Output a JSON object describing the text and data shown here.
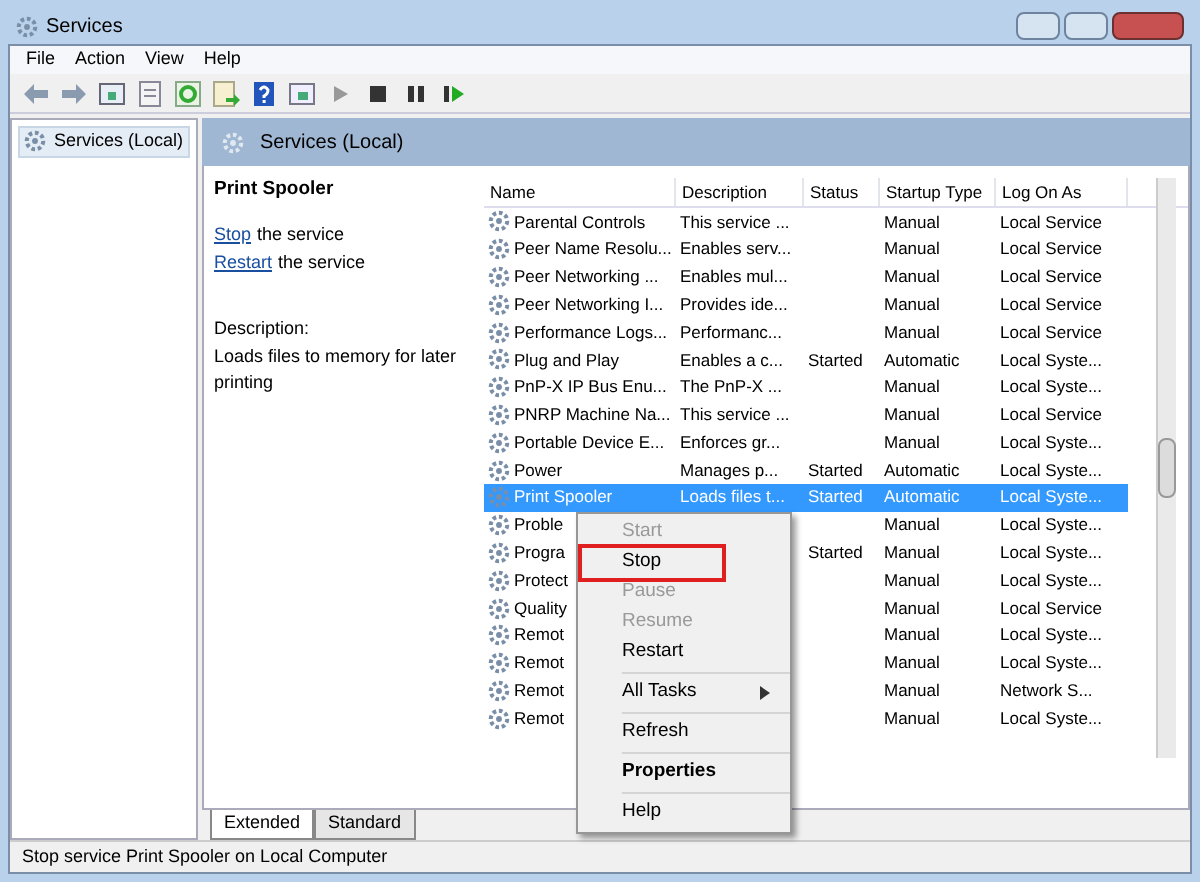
{
  "window": {
    "title": "Services"
  },
  "menu_bar": [
    "File",
    "Action",
    "View",
    "Help"
  ],
  "tree": {
    "items": [
      {
        "label": "Services (Local)",
        "selected": true
      }
    ]
  },
  "pane_header": {
    "title": "Services (Local)"
  },
  "details": {
    "title": "Print Spooler",
    "actions": [
      {
        "link": "Stop",
        "text": "the service"
      },
      {
        "link": "Restart",
        "text": "the service"
      }
    ],
    "description_label": "Description:",
    "description": "Loads files to memory for later printing"
  },
  "table": {
    "columns": [
      "Name",
      "Description",
      "Status",
      "Startup Type",
      "Log On As"
    ],
    "rows": [
      {
        "cells": [
          "Parental Controls",
          "This service ...",
          "",
          "Manual",
          "Local Service"
        ],
        "selected": false
      },
      {
        "cells": [
          "Peer Name Resolu...",
          "Enables serv...",
          "",
          "Manual",
          "Local Service"
        ],
        "selected": false
      },
      {
        "cells": [
          "Peer Networking ...",
          "Enables mul...",
          "",
          "Manual",
          "Local Service"
        ],
        "selected": false
      },
      {
        "cells": [
          "Peer Networking I...",
          "Provides ide...",
          "",
          "Manual",
          "Local Service"
        ],
        "selected": false
      },
      {
        "cells": [
          "Performance Logs...",
          "Performanc...",
          "",
          "Manual",
          "Local Service"
        ],
        "selected": false
      },
      {
        "cells": [
          "Plug and Play",
          "Enables a c...",
          "Started",
          "Automatic",
          "Local Syste..."
        ],
        "selected": false
      },
      {
        "cells": [
          "PnP-X IP Bus Enu...",
          "The PnP-X ...",
          "",
          "Manual",
          "Local Syste..."
        ],
        "selected": false
      },
      {
        "cells": [
          "PNRP Machine Na...",
          "This service ...",
          "",
          "Manual",
          "Local Service"
        ],
        "selected": false
      },
      {
        "cells": [
          "Portable Device E...",
          "Enforces gr...",
          "",
          "Manual",
          "Local Syste..."
        ],
        "selected": false
      },
      {
        "cells": [
          "Power",
          "Manages p...",
          "Started",
          "Automatic",
          "Local Syste..."
        ],
        "selected": false
      },
      {
        "cells": [
          "Print Spooler",
          "Loads files t...",
          "Started",
          "Automatic",
          "Local Syste..."
        ],
        "selected": true
      },
      {
        "cells": [
          "Proble",
          "",
          "",
          "Manual",
          "Local Syste..."
        ],
        "selected": false
      },
      {
        "cells": [
          "Progra",
          "",
          "Started",
          "Manual",
          "Local Syste..."
        ],
        "selected": false
      },
      {
        "cells": [
          "Protect",
          "",
          "",
          "Manual",
          "Local Syste..."
        ],
        "selected": false
      },
      {
        "cells": [
          "Quality",
          "",
          "",
          "Manual",
          "Local Service"
        ],
        "selected": false
      },
      {
        "cells": [
          "Remot",
          "",
          "",
          "Manual",
          "Local Syste..."
        ],
        "selected": false
      },
      {
        "cells": [
          "Remot",
          "",
          "",
          "Manual",
          "Local Syste..."
        ],
        "selected": false
      },
      {
        "cells": [
          "Remot",
          "",
          "",
          "Manual",
          "Network S..."
        ],
        "selected": false
      },
      {
        "cells": [
          "Remot",
          "",
          "",
          "Manual",
          "Local Syste..."
        ],
        "selected": false
      }
    ]
  },
  "context_menu": [
    {
      "kind": "item",
      "label": "Start",
      "disabled": true,
      "highlighted": false
    },
    {
      "kind": "item",
      "label": "Stop",
      "disabled": false,
      "highlighted": true
    },
    {
      "kind": "item",
      "label": "Pause",
      "disabled": true,
      "highlighted": false
    },
    {
      "kind": "item",
      "label": "Resume",
      "disabled": true,
      "highlighted": false
    },
    {
      "kind": "item",
      "label": "Restart",
      "disabled": false,
      "highlighted": false
    },
    {
      "kind": "separator"
    },
    {
      "kind": "submenu",
      "label": "All Tasks",
      "disabled": false,
      "highlighted": false
    },
    {
      "kind": "separator"
    },
    {
      "kind": "item",
      "label": "Refresh",
      "disabled": false,
      "highlighted": false
    },
    {
      "kind": "separator"
    },
    {
      "kind": "default",
      "label": "Properties",
      "disabled": false,
      "highlighted": false
    },
    {
      "kind": "separator"
    },
    {
      "kind": "item",
      "label": "Help",
      "disabled": false,
      "highlighted": false
    }
  ],
  "view_tabs": [
    {
      "label": "Extended",
      "selected": true
    },
    {
      "label": "Standard",
      "selected": false
    }
  ],
  "status_bar": "Stop service Print Spooler on Local Computer"
}
